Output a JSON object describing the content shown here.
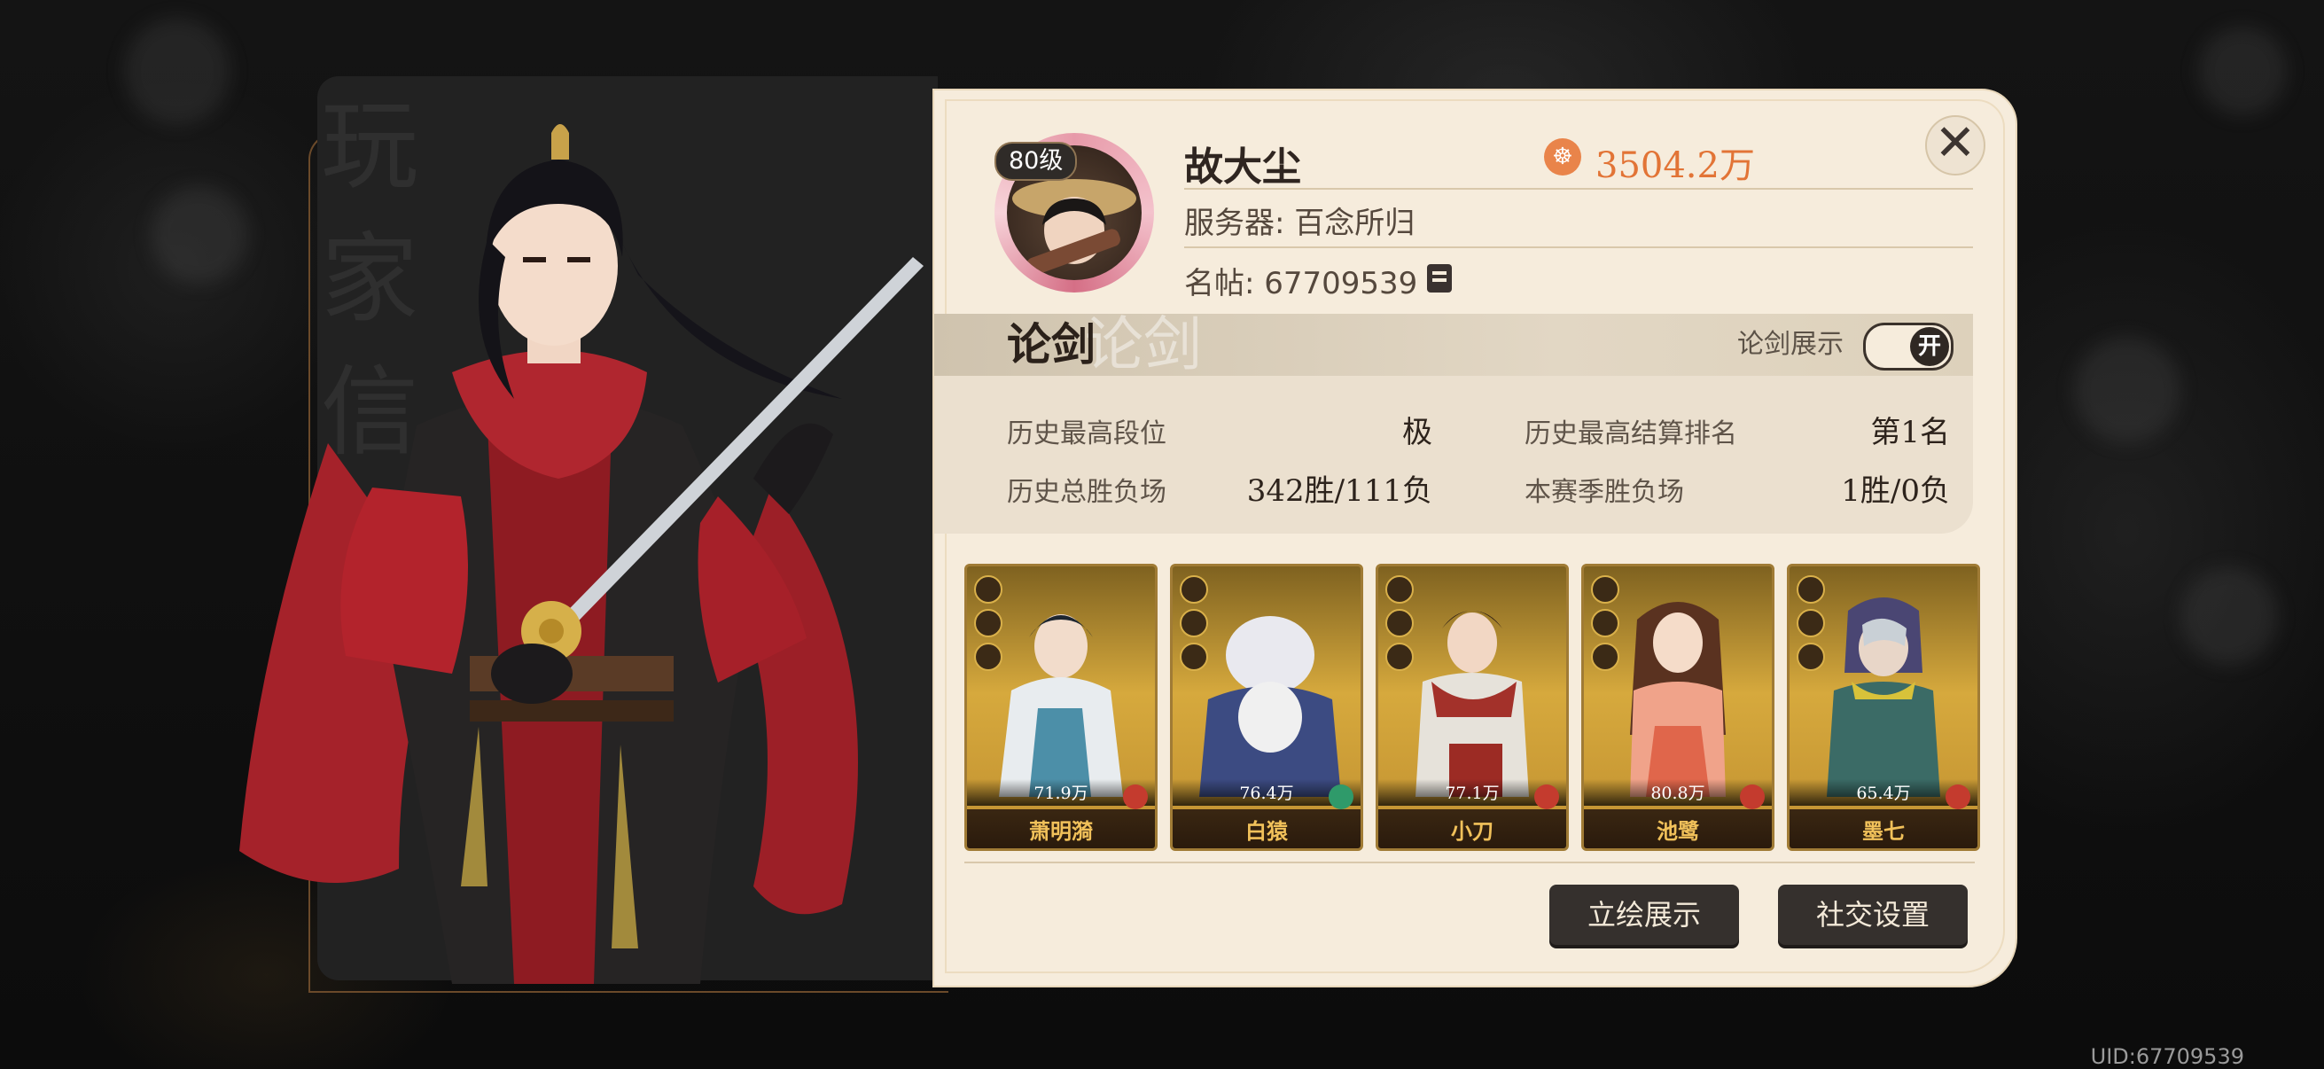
{
  "player": {
    "name": "故大尘",
    "level": "80级",
    "power": "3504.2万",
    "server": "服务器: 百念所归",
    "card_id": "名帖: 67709539"
  },
  "portrait_watermark": "玩家信",
  "section": {
    "title": "论剑",
    "title_ghost": "论剑",
    "toggle_label": "论剑展示",
    "toggle_state": "开"
  },
  "stats": {
    "best_rank_label": "历史最高段位",
    "best_rank_value": "极",
    "best_settle_label": "历史最高结算排名",
    "best_settle_value": "第1名",
    "total_record_label": "历史总胜负场",
    "total_record_value": "342胜/111负",
    "season_record_label": "本赛季胜负场",
    "season_record_value": "1胜/0负"
  },
  "heroes": [
    {
      "name": "萧明漪",
      "power": "71.9万",
      "element": "fire"
    },
    {
      "name": "白猿",
      "power": "76.4万",
      "element": "wind"
    },
    {
      "name": "小刀",
      "power": "77.1万",
      "element": "fire"
    },
    {
      "name": "池鹭",
      "power": "80.8万",
      "element": "fire"
    },
    {
      "name": "墨七",
      "power": "65.4万",
      "element": "fire"
    }
  ],
  "buttons": {
    "portrait_show": "立绘展示",
    "social_settings": "社交设置"
  },
  "uid": "UID:67709539",
  "colors": {
    "panel_bg": "#f6ecdc",
    "power_orange": "#e27436",
    "button_dark": "#35302d",
    "card_gold": "#d6a93d"
  }
}
